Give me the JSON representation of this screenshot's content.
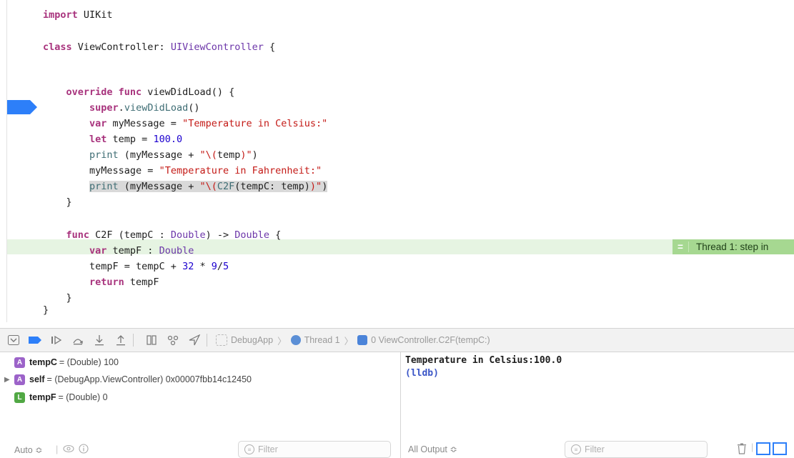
{
  "editor": {
    "lines": [
      {
        "parts": [
          {
            "t": "import",
            "c": "kw"
          },
          {
            "t": " UIKit",
            "c": "plain"
          }
        ]
      },
      {
        "parts": [
          {
            "t": "class",
            "c": "kw"
          },
          {
            "t": " ViewController: ",
            "c": "plain"
          },
          {
            "t": "UIViewController",
            "c": "ty"
          },
          {
            "t": " {",
            "c": "plain"
          }
        ]
      },
      {
        "parts": [
          {
            "t": "    override func",
            "c": "kw"
          },
          {
            "t": " viewDidLoad() {",
            "c": "plain"
          }
        ]
      },
      {
        "parts": [
          {
            "t": "        super",
            "c": "kw"
          },
          {
            "t": ".",
            "c": "plain"
          },
          {
            "t": "viewDidLoad",
            "c": "fn"
          },
          {
            "t": "()",
            "c": "plain"
          }
        ]
      },
      {
        "parts": [
          {
            "t": "        var",
            "c": "kw"
          },
          {
            "t": " myMessage = ",
            "c": "plain"
          },
          {
            "t": "\"Temperature in Celsius:\"",
            "c": "str"
          }
        ]
      },
      {
        "parts": [
          {
            "t": "        let",
            "c": "kw"
          },
          {
            "t": " temp = ",
            "c": "plain"
          },
          {
            "t": "100.0",
            "c": "num"
          }
        ]
      },
      {
        "parts": [
          {
            "t": "        print",
            "c": "fn"
          },
          {
            "t": " (myMessage + ",
            "c": "plain"
          },
          {
            "t": "\"\\(",
            "c": "str"
          },
          {
            "t": "temp",
            "c": "plain"
          },
          {
            "t": ")\"",
            "c": "str"
          },
          {
            "t": ")",
            "c": "plain"
          }
        ]
      },
      {
        "parts": [
          {
            "t": "        myMessage = ",
            "c": "plain"
          },
          {
            "t": "\"Temperature in Fahrenheit:\"",
            "c": "str"
          }
        ]
      },
      {
        "parts": [
          {
            "t": "        print",
            "c": "fn"
          },
          {
            "t": " (myMessage + ",
            "c": "plain"
          },
          {
            "t": "\"\\(",
            "c": "str"
          },
          {
            "t": "C2F",
            "c": "fn"
          },
          {
            "t": "(tempC: temp)",
            "c": "plain"
          },
          {
            "t": ")\"",
            "c": "str"
          },
          {
            "t": ")",
            "c": "plain"
          }
        ]
      },
      {
        "parts": [
          {
            "t": "    }",
            "c": "plain"
          }
        ]
      },
      {
        "parts": [
          {
            "t": "    func",
            "c": "kw"
          },
          {
            "t": " C2F (tempC : ",
            "c": "plain"
          },
          {
            "t": "Double",
            "c": "ty"
          },
          {
            "t": ") -> ",
            "c": "plain"
          },
          {
            "t": "Double",
            "c": "ty"
          },
          {
            "t": " {",
            "c": "plain"
          }
        ]
      },
      {
        "parts": [
          {
            "t": "        var",
            "c": "kw"
          },
          {
            "t": " tempF : ",
            "c": "plain"
          },
          {
            "t": "Double",
            "c": "ty"
          }
        ]
      },
      {
        "parts": [
          {
            "t": "        tempF = tempC + ",
            "c": "plain"
          },
          {
            "t": "32",
            "c": "num"
          },
          {
            "t": " * ",
            "c": "plain"
          },
          {
            "t": "9",
            "c": "num"
          },
          {
            "t": "/",
            "c": "plain"
          },
          {
            "t": "5",
            "c": "num"
          }
        ]
      },
      {
        "parts": [
          {
            "t": "        return",
            "c": "kw"
          },
          {
            "t": " tempF",
            "c": "plain"
          }
        ]
      },
      {
        "parts": [
          {
            "t": "    }",
            "c": "plain"
          }
        ]
      },
      {
        "parts": [
          {
            "t": "}",
            "c": "plain"
          }
        ]
      }
    ],
    "thread_badge": "Thread 1: step in"
  },
  "debug_bar": {
    "app": "DebugApp",
    "thread": "Thread 1",
    "frame": "0 ViewController.C2F(tempC:)"
  },
  "variables": [
    {
      "kind": "A",
      "name": "tempC",
      "value": "= (Double) 100",
      "expandable": false
    },
    {
      "kind": "A",
      "name": "self",
      "value": "= (DebugApp.ViewController) 0x00007fbb14c12450",
      "expandable": true
    },
    {
      "kind": "L",
      "name": "tempF",
      "value": "= (Double) 0",
      "expandable": false
    }
  ],
  "vars_footer": {
    "mode": "Auto ≎",
    "filter_placeholder": "Filter"
  },
  "console": {
    "output": "Temperature in Celsius:100.0",
    "prompt": "(lldb)"
  },
  "console_footer": {
    "mode": "All Output ≎",
    "filter_placeholder": "Filter"
  }
}
